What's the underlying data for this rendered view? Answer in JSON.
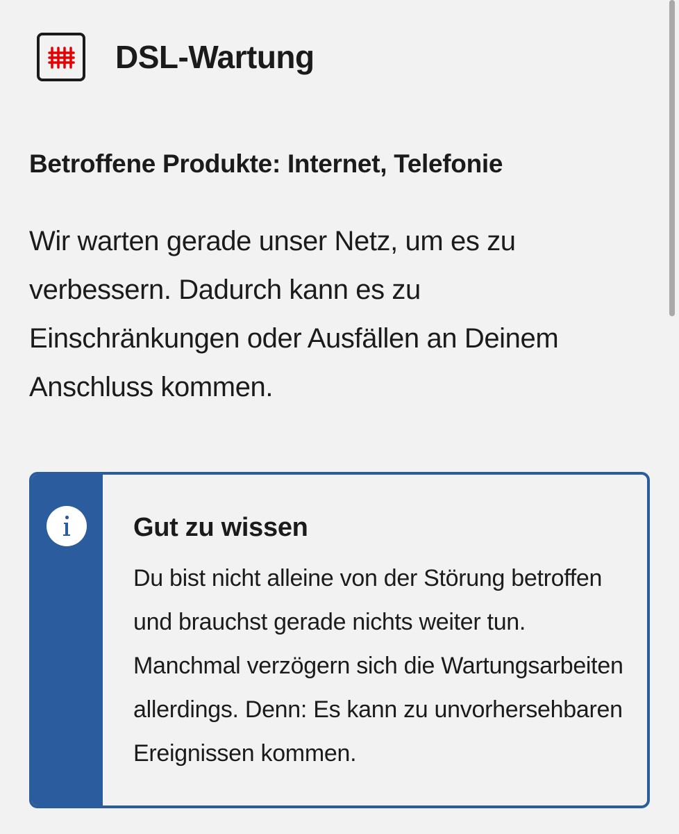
{
  "header": {
    "title": "DSL-Wartung",
    "icon": "dsl-maintenance-icon"
  },
  "affected_products": "Betroffene Produkte: Internet, Telefonie",
  "description": "Wir warten gerade unser Netz, um es zu verbessern. Dadurch kann es zu Einschränkungen oder Ausfällen an Deinem Anschluss kommen.",
  "info_box": {
    "icon": "info-icon",
    "title": "Gut zu wissen",
    "text": "Du bist nicht alleine von der Störung betroffen und brauchst gerade nichts weiter tun. Manchmal verzögern sich die Wartungsarbeiten allerdings. Denn: Es kann zu unvorhersehbaren Ereignissen kommen."
  },
  "colors": {
    "background": "#f2f2f2",
    "accent_red": "#e60000",
    "info_blue": "#2a5c9e",
    "text": "#1b1b1b"
  }
}
